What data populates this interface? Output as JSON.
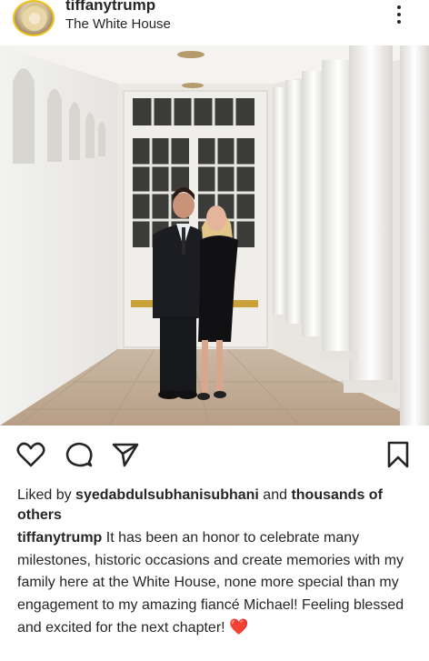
{
  "post": {
    "username": "tiffanytrump",
    "location": "The White House"
  },
  "icons": {
    "avatar": "profile-avatar",
    "more": "more-options-icon",
    "like": "heart-icon",
    "comment": "comment-icon",
    "share": "send-icon",
    "save": "bookmark-icon"
  },
  "likes": {
    "prefix": "Liked by ",
    "user": "syedabdulsubhanisubhani",
    "conj": " and ",
    "rest": "thousands of others"
  },
  "caption": {
    "author": "tiffanytrump",
    "text": " It has been an honor to celebrate many milestones, historic occasions and create memories with my family here at the White House, none more special than my engagement to my amazing fiancé Michael! Feeling blessed and excited for the next chapter! ",
    "emoji": "❤️"
  },
  "colors": {
    "text": "#262626",
    "heart_emoji": "#d81f26",
    "avatar_ring": "#f0c419"
  }
}
